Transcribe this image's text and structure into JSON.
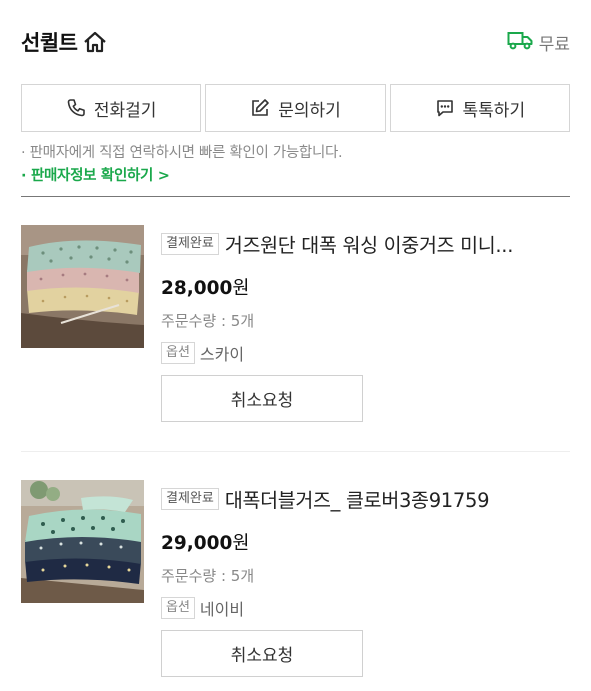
{
  "store": {
    "name": "선퀼트",
    "shipping_label": "무료",
    "accent_color": "#1aa84b"
  },
  "contact": {
    "call_label": "전화걸기",
    "inquiry_label": "문의하기",
    "talk_label": "톡톡하기"
  },
  "notice": {
    "text": "· 판매자에게 직접 연락하시면 빠른 확인이 가능합니다.",
    "seller_link": "· 판매자정보 확인하기 >"
  },
  "orders": [
    {
      "status": "결제완료",
      "title": "거즈원단 대폭 워싱 이중거즈 미니...",
      "price": "28,000",
      "price_unit": "원",
      "quantity": "주문수량 : 5개",
      "option_label": "옵션",
      "option_value": "스카이",
      "cancel_label": "취소요청"
    },
    {
      "status": "결제완료",
      "title": "대폭더블거즈_ 클로버3종91759",
      "price": "29,000",
      "price_unit": "원",
      "quantity": "주문수량 : 5개",
      "option_label": "옵션",
      "option_value": "네이비",
      "cancel_label": "취소요청"
    }
  ]
}
